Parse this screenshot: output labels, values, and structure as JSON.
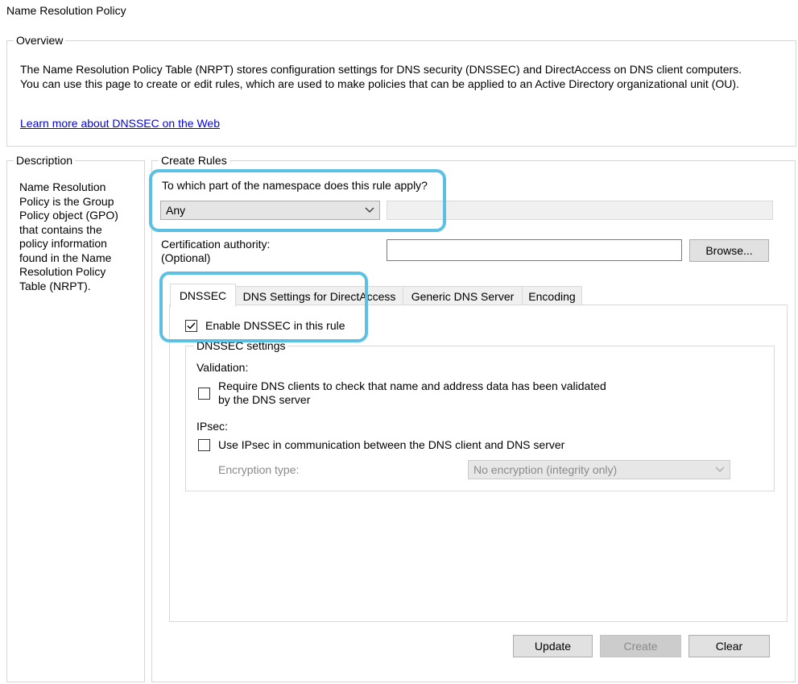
{
  "page": {
    "title": "Name Resolution Policy"
  },
  "overview": {
    "legend": "Overview",
    "line1": "The Name Resolution Policy Table (NRPT) stores configuration settings for DNS security (DNSSEC) and DirectAccess on DNS client computers.",
    "line2": "You can use this page to create or edit rules, which are used to make policies that can be applied to an Active Directory organizational unit (OU).",
    "link": "Learn more about DNSSEC on the Web"
  },
  "description": {
    "legend": "Description",
    "text": "Name Resolution Policy is the Group Policy object (GPO) that contains the policy information found in the Name Resolution Policy Table (NRPT)."
  },
  "create_rules": {
    "legend": "Create Rules",
    "namespace_question": "To which part of the namespace does this rule apply?",
    "namespace_value": "Any",
    "namespace_text_value": "",
    "ca_label_line1": "Certification authority:",
    "ca_label_line2": "(Optional)",
    "ca_value": "",
    "browse_label": "Browse..."
  },
  "tabs": [
    {
      "label": "DNSSEC",
      "active": true
    },
    {
      "label": "DNS Settings for DirectAccess",
      "active": false
    },
    {
      "label": "Generic DNS Server",
      "active": false
    },
    {
      "label": "Encoding",
      "active": false
    }
  ],
  "dnssec": {
    "enable_label": "Enable DNSSEC in this rule",
    "enable_checked": true,
    "settings_legend": "DNSSEC settings",
    "validation_label": "Validation:",
    "require_label_line1": "Require DNS clients to check that name and address data has been validated",
    "require_label_line2": "by the DNS server",
    "require_checked": false,
    "ipsec_label": "IPsec:",
    "ipsec_use_label": "Use IPsec in communication between the DNS client and DNS server",
    "ipsec_checked": false,
    "encryption_label": "Encryption type:",
    "encryption_value": "No encryption (integrity only)"
  },
  "buttons": {
    "update": "Update",
    "create": "Create",
    "clear": "Clear"
  },
  "colors": {
    "highlight": "#5bc0e3",
    "link": "#0000ee"
  },
  "icons": {
    "dropdown": "chevron-down-icon",
    "check": "checkmark-icon"
  }
}
